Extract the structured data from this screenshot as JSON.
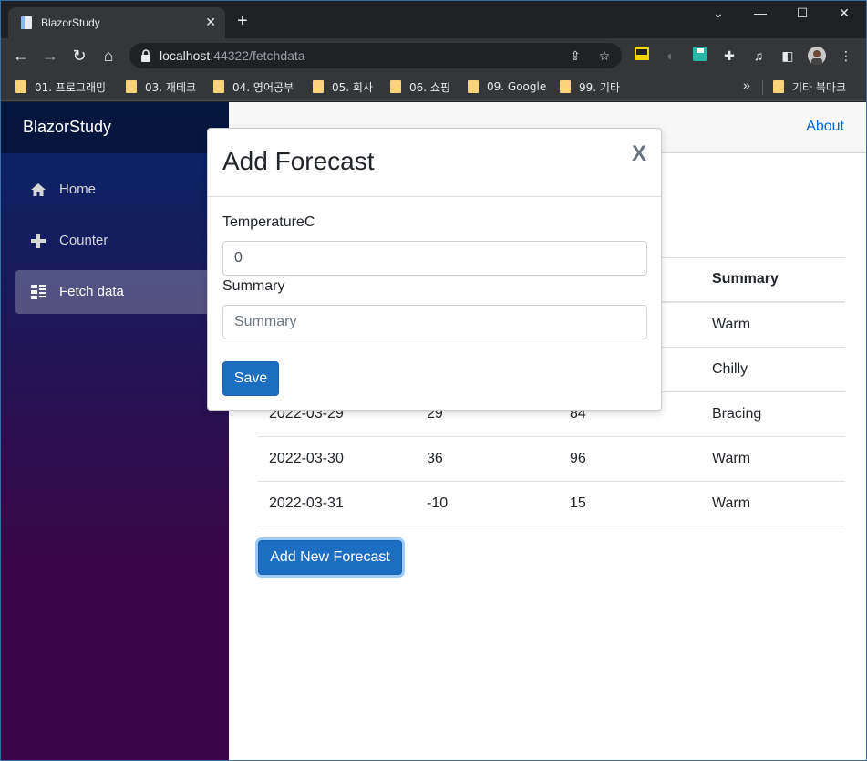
{
  "browser": {
    "tab_title": "BlazorStudy",
    "tab_close": "✕",
    "new_tab": "+",
    "url_host": "localhost",
    "url_path": ":44322/fetchdata",
    "window_controls": {
      "minimize": "—",
      "maximize": "☐",
      "close": "✕",
      "dropdown": "⌄"
    },
    "bookmarks": [
      "01. 프로그래밍",
      "03. 재테크",
      "04. 영어공부",
      "05. 회사",
      "06. 쇼핑",
      "09. Google",
      "99. 기타"
    ],
    "bookmarks_more": "»",
    "other_bookmarks": "기타 북마크"
  },
  "app": {
    "brand": "BlazorStudy",
    "nav": [
      {
        "label": "Home",
        "icon": "home-icon"
      },
      {
        "label": "Counter",
        "icon": "plus-icon"
      },
      {
        "label": "Fetch data",
        "icon": "list-icon"
      }
    ],
    "about": "About"
  },
  "table": {
    "header_summary": "Summary",
    "rows": [
      {
        "date": "",
        "temp_c": "",
        "temp_f": "",
        "summary": "Warm"
      },
      {
        "date": "",
        "temp_c": "",
        "temp_f": "",
        "summary": "Chilly"
      },
      {
        "date": "2022-03-29",
        "temp_c": "29",
        "temp_f": "84",
        "summary": "Bracing"
      },
      {
        "date": "2022-03-30",
        "temp_c": "36",
        "temp_f": "96",
        "summary": "Warm"
      },
      {
        "date": "2022-03-31",
        "temp_c": "-10",
        "temp_f": "15",
        "summary": "Warm"
      }
    ]
  },
  "add_button": "Add New Forecast",
  "modal": {
    "title": "Add Forecast",
    "close": "X",
    "temp_label": "TemperatureC",
    "temp_value": "0",
    "summary_label": "Summary",
    "summary_placeholder": "Summary",
    "save": "Save"
  },
  "colors": {
    "accent": "#1b6ec2",
    "link": "#0366d6",
    "sidebar_top": "#052767",
    "sidebar_bottom": "#3a0647"
  }
}
